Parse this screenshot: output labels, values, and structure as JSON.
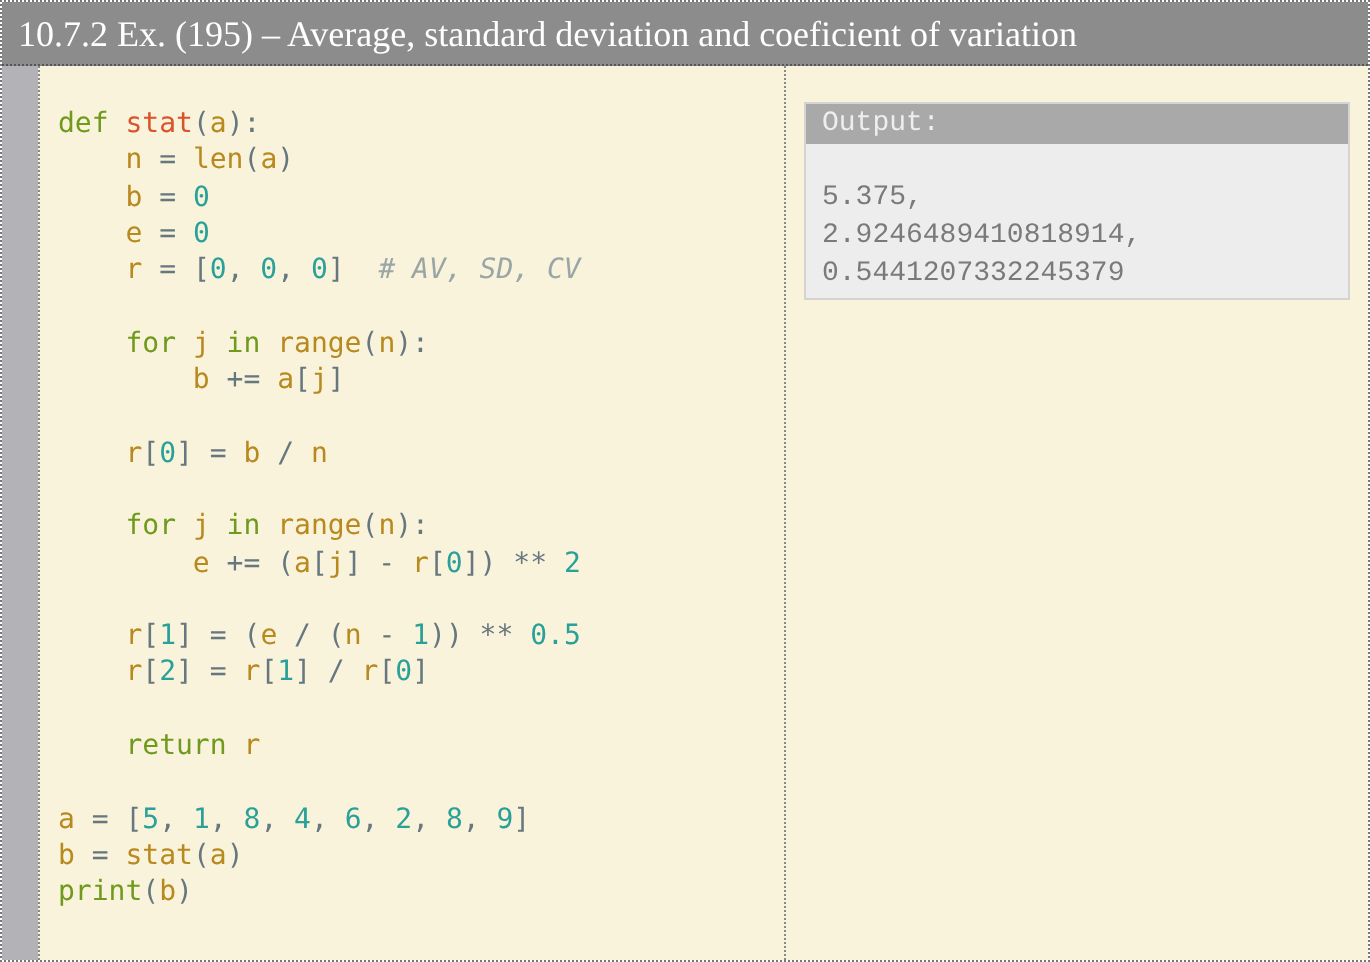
{
  "title": "10.7.2 Ex. (195) – Average, standard deviation and coeficient of variation",
  "code_blocks": [
    {
      "lines": [
        [
          {
            "kind": "kw",
            "text": "def "
          },
          {
            "kind": "fn",
            "text": "stat"
          },
          {
            "kind": "p",
            "text": "("
          },
          {
            "kind": "var",
            "text": "a"
          },
          {
            "kind": "p",
            "text": "):"
          }
        ],
        [
          {
            "kind": "var",
            "text": "    n"
          },
          {
            "kind": "p",
            "text": " = "
          },
          {
            "kind": "var",
            "text": "len"
          },
          {
            "kind": "p",
            "text": "("
          },
          {
            "kind": "var",
            "text": "a"
          },
          {
            "kind": "p",
            "text": ")"
          }
        ],
        [
          {
            "kind": "var",
            "text": "    b"
          },
          {
            "kind": "p",
            "text": " = "
          },
          {
            "kind": "num",
            "text": "0"
          }
        ],
        [
          {
            "kind": "var",
            "text": "    e"
          },
          {
            "kind": "p",
            "text": " = "
          },
          {
            "kind": "num",
            "text": "0"
          }
        ],
        [
          {
            "kind": "var",
            "text": "    r"
          },
          {
            "kind": "p",
            "text": " = ["
          },
          {
            "kind": "num",
            "text": "0"
          },
          {
            "kind": "p",
            "text": ", "
          },
          {
            "kind": "num",
            "text": "0"
          },
          {
            "kind": "p",
            "text": ", "
          },
          {
            "kind": "num",
            "text": "0"
          },
          {
            "kind": "p",
            "text": "]  "
          },
          {
            "kind": "cm",
            "text": "# AV, SD, CV"
          }
        ]
      ]
    },
    {
      "lines": [
        [
          {
            "kind": "kw",
            "text": "    for "
          },
          {
            "kind": "var",
            "text": "j "
          },
          {
            "kind": "kw",
            "text": "in "
          },
          {
            "kind": "var",
            "text": "range"
          },
          {
            "kind": "p",
            "text": "("
          },
          {
            "kind": "var",
            "text": "n"
          },
          {
            "kind": "p",
            "text": "):"
          }
        ],
        [
          {
            "kind": "var",
            "text": "        b"
          },
          {
            "kind": "p",
            "text": " += "
          },
          {
            "kind": "var",
            "text": "a"
          },
          {
            "kind": "p",
            "text": "["
          },
          {
            "kind": "var",
            "text": "j"
          },
          {
            "kind": "p",
            "text": "]"
          }
        ]
      ]
    },
    {
      "lines": [
        [
          {
            "kind": "var",
            "text": "    r"
          },
          {
            "kind": "p",
            "text": "["
          },
          {
            "kind": "num",
            "text": "0"
          },
          {
            "kind": "p",
            "text": "] = "
          },
          {
            "kind": "var",
            "text": "b"
          },
          {
            "kind": "p",
            "text": " / "
          },
          {
            "kind": "var",
            "text": "n"
          }
        ]
      ]
    },
    {
      "lines": [
        [
          {
            "kind": "kw",
            "text": "    for "
          },
          {
            "kind": "var",
            "text": "j "
          },
          {
            "kind": "kw",
            "text": "in "
          },
          {
            "kind": "var",
            "text": "range"
          },
          {
            "kind": "p",
            "text": "("
          },
          {
            "kind": "var",
            "text": "n"
          },
          {
            "kind": "p",
            "text": "):"
          }
        ],
        [
          {
            "kind": "var",
            "text": "        e"
          },
          {
            "kind": "p",
            "text": " += ("
          },
          {
            "kind": "var",
            "text": "a"
          },
          {
            "kind": "p",
            "text": "["
          },
          {
            "kind": "var",
            "text": "j"
          },
          {
            "kind": "p",
            "text": "] - "
          },
          {
            "kind": "var",
            "text": "r"
          },
          {
            "kind": "p",
            "text": "["
          },
          {
            "kind": "num",
            "text": "0"
          },
          {
            "kind": "p",
            "text": "]) ** "
          },
          {
            "kind": "num",
            "text": "2"
          }
        ]
      ]
    },
    {
      "lines": [
        [
          {
            "kind": "var",
            "text": "    r"
          },
          {
            "kind": "p",
            "text": "["
          },
          {
            "kind": "num",
            "text": "1"
          },
          {
            "kind": "p",
            "text": "] = ("
          },
          {
            "kind": "var",
            "text": "e"
          },
          {
            "kind": "p",
            "text": " / ("
          },
          {
            "kind": "var",
            "text": "n"
          },
          {
            "kind": "p",
            "text": " - "
          },
          {
            "kind": "num",
            "text": "1"
          },
          {
            "kind": "p",
            "text": ")) ** "
          },
          {
            "kind": "num",
            "text": "0.5"
          }
        ],
        [
          {
            "kind": "var",
            "text": "    r"
          },
          {
            "kind": "p",
            "text": "["
          },
          {
            "kind": "num",
            "text": "2"
          },
          {
            "kind": "p",
            "text": "] = "
          },
          {
            "kind": "var",
            "text": "r"
          },
          {
            "kind": "p",
            "text": "["
          },
          {
            "kind": "num",
            "text": "1"
          },
          {
            "kind": "p",
            "text": "] / "
          },
          {
            "kind": "var",
            "text": "r"
          },
          {
            "kind": "p",
            "text": "["
          },
          {
            "kind": "num",
            "text": "0"
          },
          {
            "kind": "p",
            "text": "]"
          }
        ]
      ]
    },
    {
      "lines": [
        [
          {
            "kind": "kw",
            "text": "    return "
          },
          {
            "kind": "var",
            "text": "r"
          }
        ]
      ]
    },
    {
      "lines": [
        [
          {
            "kind": "var",
            "text": "a"
          },
          {
            "kind": "p",
            "text": " = ["
          },
          {
            "kind": "num",
            "text": "5"
          },
          {
            "kind": "p",
            "text": ", "
          },
          {
            "kind": "num",
            "text": "1"
          },
          {
            "kind": "p",
            "text": ", "
          },
          {
            "kind": "num",
            "text": "8"
          },
          {
            "kind": "p",
            "text": ", "
          },
          {
            "kind": "num",
            "text": "4"
          },
          {
            "kind": "p",
            "text": ", "
          },
          {
            "kind": "num",
            "text": "6"
          },
          {
            "kind": "p",
            "text": ", "
          },
          {
            "kind": "num",
            "text": "2"
          },
          {
            "kind": "p",
            "text": ", "
          },
          {
            "kind": "num",
            "text": "8"
          },
          {
            "kind": "p",
            "text": ", "
          },
          {
            "kind": "num",
            "text": "9"
          },
          {
            "kind": "p",
            "text": "]"
          }
        ],
        [
          {
            "kind": "var",
            "text": "b"
          },
          {
            "kind": "p",
            "text": " = "
          },
          {
            "kind": "var",
            "text": "stat"
          },
          {
            "kind": "p",
            "text": "("
          },
          {
            "kind": "var",
            "text": "a"
          },
          {
            "kind": "p",
            "text": ")"
          }
        ],
        [
          {
            "kind": "kw",
            "text": "print"
          },
          {
            "kind": "p",
            "text": "("
          },
          {
            "kind": "var",
            "text": "b"
          },
          {
            "kind": "p",
            "text": ")"
          }
        ]
      ]
    }
  ],
  "output": {
    "label": "Output:",
    "lines": [
      "5.375,",
      "2.9246489410818914,",
      "0.5441207332245379"
    ]
  }
}
